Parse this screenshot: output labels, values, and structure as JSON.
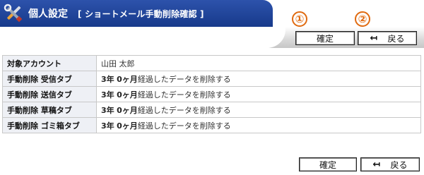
{
  "header": {
    "title": "個人設定",
    "subtitle": "[ ショートメール手動削除確認 ]"
  },
  "annotations": {
    "marker1": "①",
    "marker2": "②"
  },
  "toolbar": {
    "confirm_label": "確定",
    "back_label": "戻る"
  },
  "rows": [
    {
      "label": "対象アカウント",
      "value": "山田 太郎"
    },
    {
      "label": "手動削除 受信タブ",
      "years": "3年",
      "months": "0ヶ月",
      "text": "経過したデータを削除する"
    },
    {
      "label": "手動削除 送信タブ",
      "years": "3年",
      "months": "0ヶ月",
      "text": "経過したデータを削除する"
    },
    {
      "label": "手動削除 草稿タブ",
      "years": "3年",
      "months": "0ヶ月",
      "text": "経過したデータを削除する"
    },
    {
      "label": "手動削除 ゴミ箱タブ",
      "years": "3年",
      "months": "0ヶ月",
      "text": "経過したデータを削除する"
    }
  ],
  "colors": {
    "header_blue": "#1f45a0",
    "annotation_orange": "#e06a10"
  }
}
